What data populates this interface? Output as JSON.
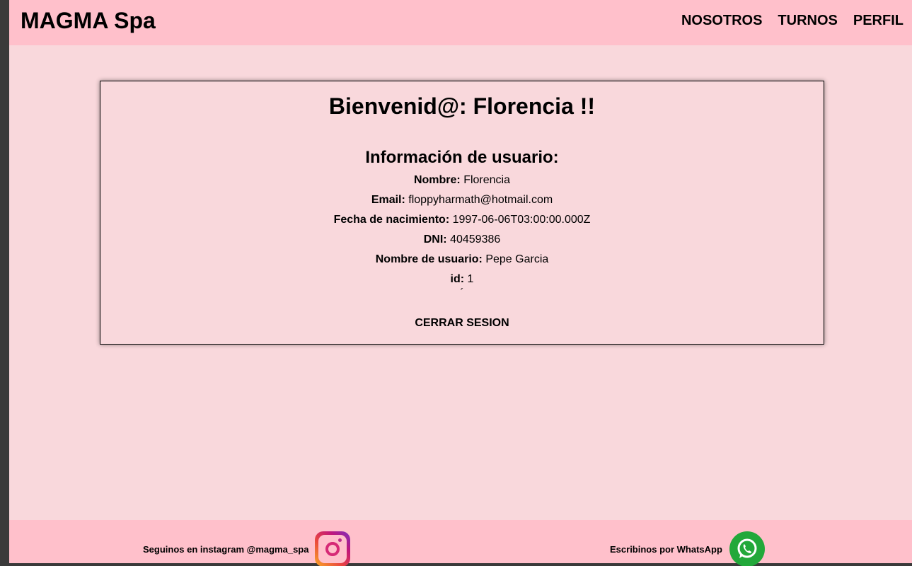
{
  "header": {
    "brand": "MAGMA Spa",
    "nav": [
      "NOSOTROS",
      "TURNOS",
      "PERFIL"
    ]
  },
  "profile": {
    "welcome": "Bienvenid@: Florencia !!",
    "info_title": "Información de usuario:",
    "fields": [
      {
        "label": "Nombre:",
        "value": "Florencia"
      },
      {
        "label": "Email:",
        "value": "floppyharmath@hotmail.com"
      },
      {
        "label": "Fecha de nacimiento:",
        "value": "1997-06-06T03:00:00.000Z"
      },
      {
        "label": "DNI:",
        "value": "40459386"
      },
      {
        "label": "Nombre de usuario:",
        "value": "Pepe Garcia"
      },
      {
        "label": "id:",
        "value": "1"
      }
    ],
    "stray_char": "´",
    "logout_label": "CERRAR SESION"
  },
  "footer": {
    "instagram_text": "Seguinos en instagram @magma_spa",
    "whatsapp_text": "Escribinos por WhatsApp",
    "instagram_icon": "instagram-icon",
    "whatsapp_icon": "whatsapp-icon"
  },
  "colors": {
    "header_bg": "#ffc0cb",
    "page_bg": "#f9d8dc",
    "whatsapp_green": "#22a83a"
  }
}
